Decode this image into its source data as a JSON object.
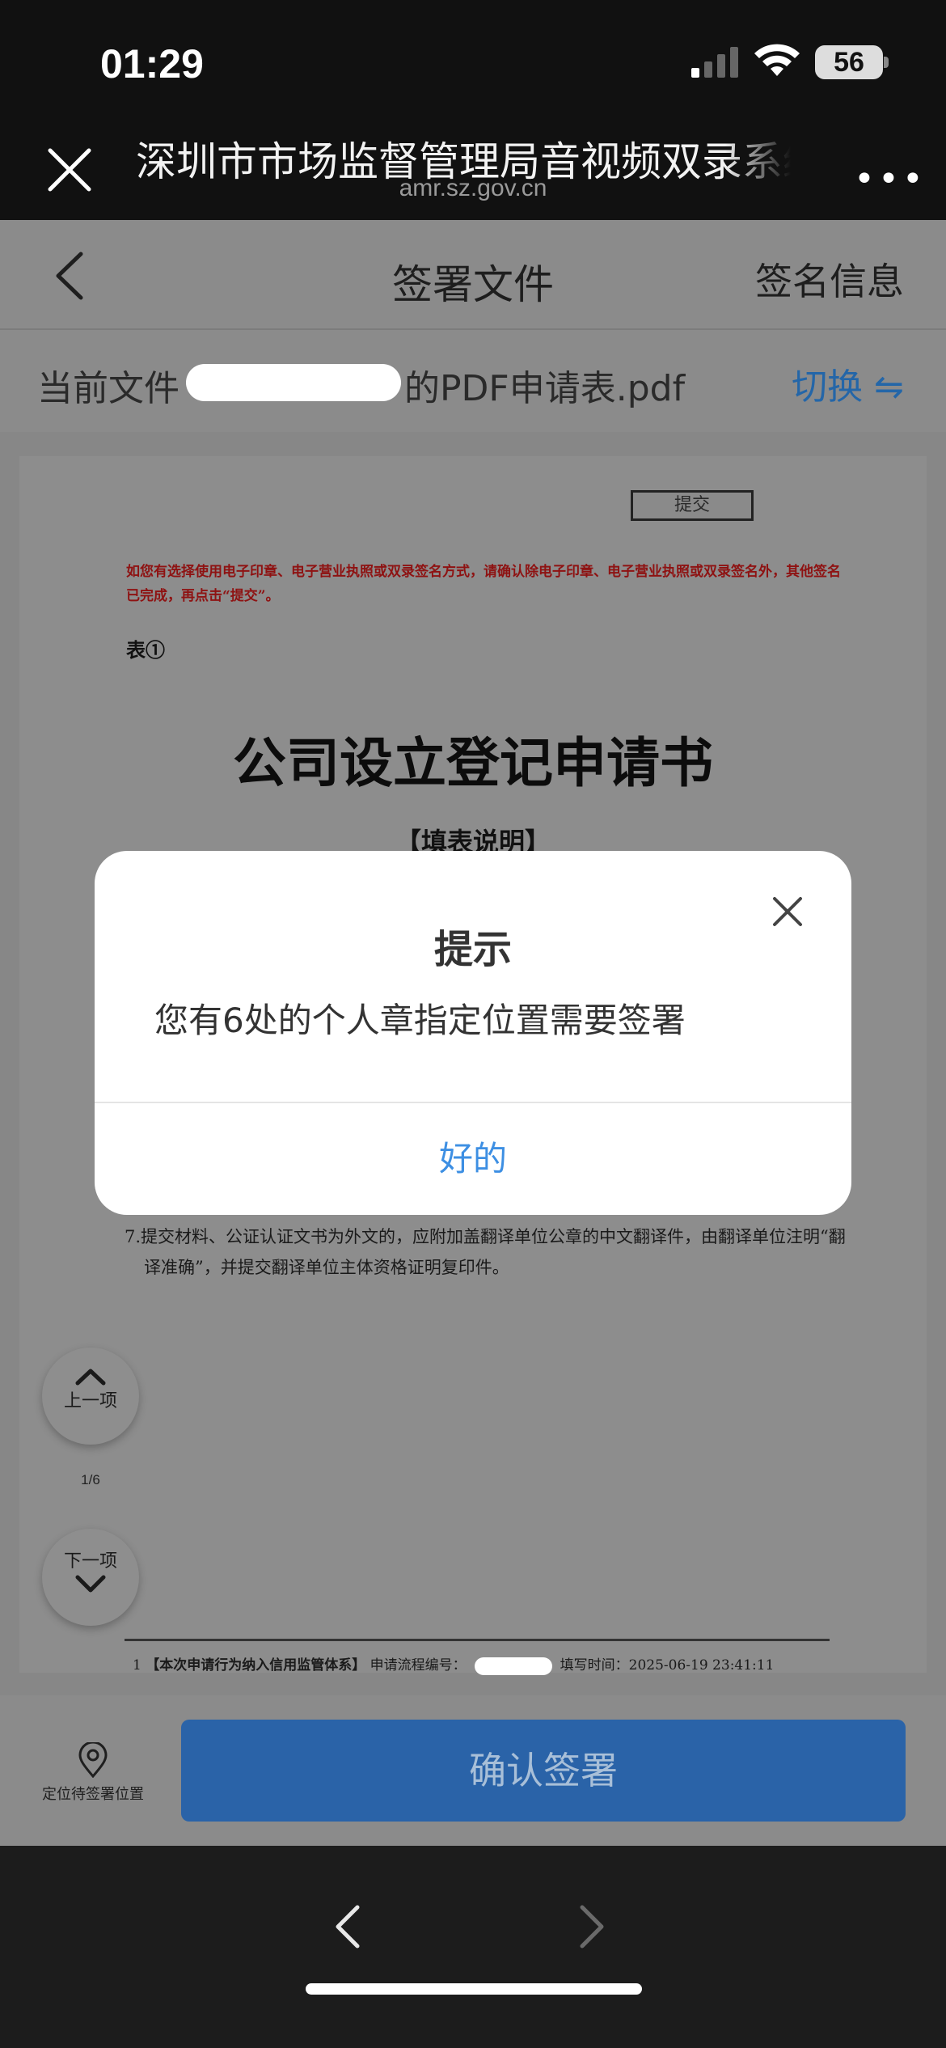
{
  "status": {
    "time": "01:29",
    "battery": "56"
  },
  "browser": {
    "title": "深圳市市场监督管理局音视频双录系统",
    "url": "amr.sz.gov.cn",
    "more_label": "•••"
  },
  "header": {
    "title": "签署文件",
    "right_link": "签名信息"
  },
  "file": {
    "label": "当前文件",
    "name_suffix": "的PDF申请表.pdf",
    "switch_label": "切换 ⇋"
  },
  "document": {
    "submit_stamp": "提交",
    "red_note": "如您有选择使用电子印章、电子营业执照或双录签名方式，请确认除电子印章、电子营业执照或双录签名外，其他签名已完成，再点击“提交”。",
    "form_number": "表①",
    "title": "公司设立登记申请书",
    "fill_instructions": "【填表说明】",
    "item7": "7.提交材料、公证认证文书为外文的，应附加盖翻译单位公章的中文翻译件，由翻译单位注明“翻译准确”，并提交翻译单位主体资格证明复印件。",
    "footer_page": "1",
    "footer_credit": "【本次申请行为纳入信用监管体系】",
    "footer_flow_label": "申请流程编号：",
    "footer_time": "填写时间：2025-06-19 23:41:11"
  },
  "navigator": {
    "prev_label": "上一项",
    "next_label": "下一项",
    "page_indicator": "1/6"
  },
  "actions": {
    "locate_label": "定位待签署位置",
    "confirm_label": "确认签署"
  },
  "modal": {
    "title": "提示",
    "message": "您有6处的个人章指定位置需要签署",
    "ok_label": "好的"
  },
  "colors": {
    "accent": "#3d8fe3",
    "confirm": "#2a63a8",
    "red_note": "#8e1212"
  }
}
